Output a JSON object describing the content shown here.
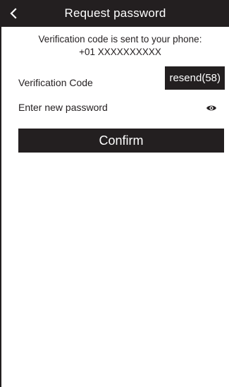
{
  "header": {
    "title": "Request password",
    "back_icon": "chevron-left-icon"
  },
  "info": {
    "line1": "Verification code is sent to your phone:",
    "line2": "+01 XXXXXXXXXX"
  },
  "verification": {
    "label": "Verification Code",
    "resend_label": "resend(58)"
  },
  "password": {
    "placeholder": "Enter new password",
    "toggle_icon": "eye-icon"
  },
  "confirm_label": "Confirm",
  "colors": {
    "dark": "#231f20",
    "background": "#ffffff",
    "text_on_dark": "#ffffff"
  }
}
